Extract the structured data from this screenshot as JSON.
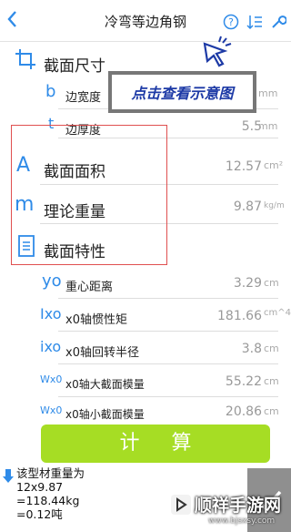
{
  "header": {
    "back_icon": "chevron-left-icon",
    "title": "冷弯等边角钢"
  },
  "section_size": {
    "label": "截面尺寸",
    "icon": "crop-icon"
  },
  "fields": {
    "width": {
      "symbol": "b",
      "label": "边宽度",
      "value": "",
      "unit": "mm"
    },
    "thickness": {
      "symbol": "t",
      "label": "边厚度",
      "value": "5.5",
      "unit": "mm"
    }
  },
  "area": {
    "symbol": "A",
    "label": "截面面积",
    "value": "12.57",
    "unit": "cm²"
  },
  "weight": {
    "symbol": "m",
    "label": "理论重量",
    "value": "9.87",
    "unit": "kg/m"
  },
  "properties": {
    "label": "截面特性",
    "icon": "document-icon"
  },
  "props": [
    {
      "symbol": "yo",
      "label": "重心距离",
      "value": "3.29",
      "unit": "cm"
    },
    {
      "symbol": "Ixo",
      "label": "x0轴惯性矩",
      "value": "181.66",
      "unit": "cm^4"
    },
    {
      "symbol": "ixo",
      "label": "x0轴回转半径",
      "value": "3.8",
      "unit": "cm"
    },
    {
      "symbol": "Wx0",
      "label": "x0轴大截面模量",
      "value": "55.22",
      "unit": "cm"
    },
    {
      "symbol": "Wx0",
      "label": "x0轴小截面模量",
      "value": "20.86",
      "unit": "cm"
    }
  ],
  "tooltip": "点击查看示意图",
  "calc_button": "计 算",
  "result": "该型材重量为\n12x9.87\n=118.44kg\n=0.12吨",
  "watermark": {
    "name": "顺祥手游网",
    "url": "www.bjsxsy.com"
  },
  "colors": {
    "accent": "#2f8be8",
    "button": "#a6dd24",
    "highlight_box": "#e05050",
    "tooltip_text": "#1d3aa6"
  }
}
